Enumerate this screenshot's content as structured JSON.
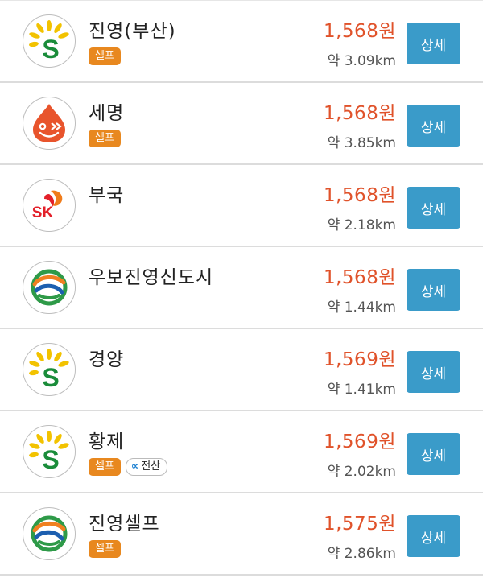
{
  "stations": [
    {
      "name": "진영(부산)",
      "brand": "s-oil-icon",
      "price": "1,568원",
      "distance": "약 3.09km",
      "tags": [
        "셀프"
      ],
      "pay": null,
      "button": "상세"
    },
    {
      "name": "세명",
      "brand": "gs-caltex-icon",
      "price": "1,568원",
      "distance": "약 3.85km",
      "tags": [
        "셀프"
      ],
      "pay": null,
      "button": "상세"
    },
    {
      "name": "부국",
      "brand": "sk-energy-icon",
      "price": "1,568원",
      "distance": "약 2.18km",
      "tags": [],
      "pay": null,
      "button": "상세"
    },
    {
      "name": "우보진영신도시",
      "brand": "hyundai-oilbank-icon",
      "price": "1,568원",
      "distance": "약 1.44km",
      "tags": [],
      "pay": null,
      "button": "상세"
    },
    {
      "name": "경양",
      "brand": "s-oil-icon",
      "price": "1,569원",
      "distance": "약 1.41km",
      "tags": [],
      "pay": null,
      "button": "상세"
    },
    {
      "name": "황제",
      "brand": "s-oil-icon",
      "price": "1,569원",
      "distance": "약 2.02km",
      "tags": [
        "셀프"
      ],
      "pay": "전산",
      "button": "상세"
    },
    {
      "name": "진영셀프",
      "brand": "hyundai-oilbank-icon",
      "price": "1,575원",
      "distance": "약 2.86km",
      "tags": [
        "셀프"
      ],
      "pay": null,
      "button": "상세"
    }
  ],
  "colors": {
    "price": "#e0522a",
    "self_tag": "#e8881f",
    "detail_button": "#3a9bc9"
  }
}
